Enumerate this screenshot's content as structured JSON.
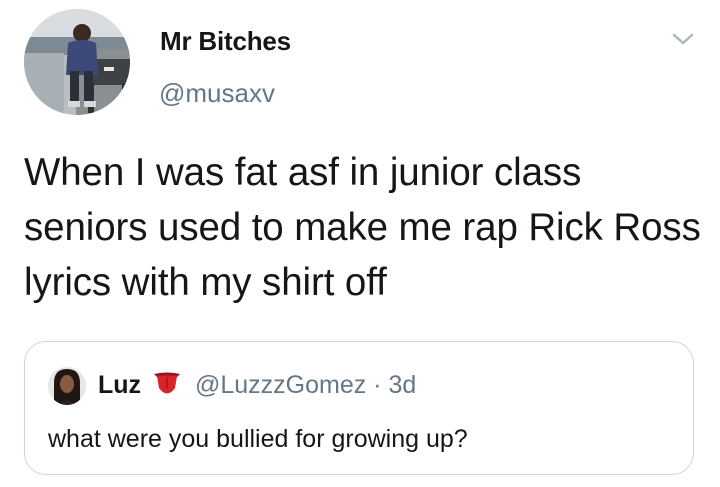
{
  "tweet": {
    "author": {
      "display_name": "Mr Bitches",
      "handle": "@musaxv"
    },
    "text": "When I was fat asf in junior class seniors used to make me rap Rick Ross lyrics with my shirt off",
    "menu_icon": "chevron-down-icon"
  },
  "quoted_tweet": {
    "author": {
      "display_name": "Luz",
      "emoji_icon": "tongue-emoji-icon",
      "handle": "@LuzzzGomez"
    },
    "separator": "·",
    "timestamp": "3d",
    "text": "what were you bullied for growing up?"
  },
  "colors": {
    "text_primary": "#14171a",
    "text_secondary": "#657786",
    "border": "#ccd6dd",
    "emoji_red": "#d8232a"
  }
}
